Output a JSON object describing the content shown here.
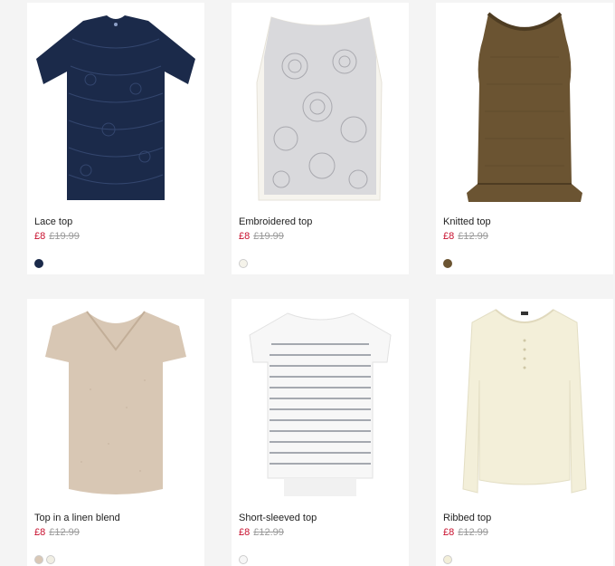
{
  "products": [
    {
      "name": "Lace top",
      "sale_price": "£8",
      "old_price": "£19.99",
      "swatch_colors": [
        "#1b2a4a"
      ]
    },
    {
      "name": "Embroidered top",
      "sale_price": "£8",
      "old_price": "£19.99",
      "swatch_colors": [
        "#f5f3ea"
      ]
    },
    {
      "name": "Knitted top",
      "sale_price": "£8",
      "old_price": "£12.99",
      "swatch_colors": [
        "#6b5432"
      ]
    },
    {
      "name": "Top in a linen blend",
      "sale_price": "£8",
      "old_price": "£12.99",
      "swatch_colors": [
        "#d9c8b6",
        "#f1efe4"
      ]
    },
    {
      "name": "Short-sleeved top",
      "sale_price": "£8",
      "old_price": "£12.99",
      "swatch_colors": [
        "#f7f7f7"
      ]
    },
    {
      "name": "Ribbed top",
      "sale_price": "£8",
      "old_price": "£12.99",
      "swatch_colors": [
        "#f3efd9"
      ]
    }
  ],
  "colors": {
    "sale": "#c8102e",
    "old_price": "#999999",
    "background": "#f4f4f4"
  }
}
